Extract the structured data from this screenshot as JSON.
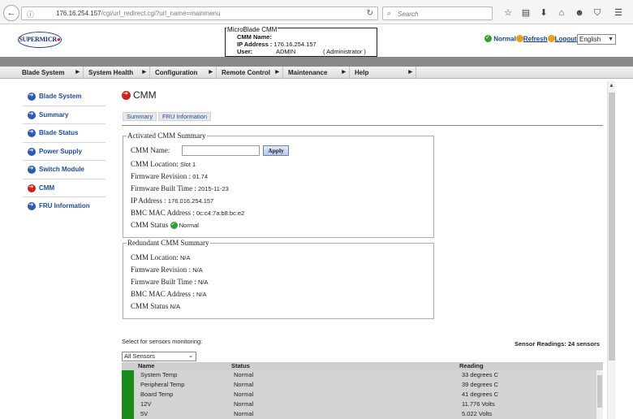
{
  "browser": {
    "url_main": "176.16.254.157",
    "url_path": "/cgi/url_redirect.cgi?url_name=mainmenu",
    "search_placeholder": "Search"
  },
  "header": {
    "logo_text": "SUPERMICR",
    "logo_dot": "●",
    "box_title": "MicroBlade CMM",
    "cmm_name_label": "CMM Name:",
    "ip_label": "IP Address :",
    "ip_value": "176.16.254.157",
    "user_label": "User:",
    "user_value": "ADMIN",
    "user_role": "( Administrator )",
    "status": "Normal",
    "refresh": "Refresh",
    "logout": "Logout",
    "language": "English"
  },
  "menu": [
    {
      "label": "Blade System"
    },
    {
      "label": "System Health"
    },
    {
      "label": "Configuration"
    },
    {
      "label": "Remote Control"
    },
    {
      "label": "Maintenance"
    },
    {
      "label": "Help"
    }
  ],
  "sidebar": [
    {
      "label": "Blade System"
    },
    {
      "label": "Summary"
    },
    {
      "label": "Blade Status"
    },
    {
      "label": "Power Supply"
    },
    {
      "label": "Switch Module"
    },
    {
      "label": "CMM"
    },
    {
      "label": "FRU Information"
    }
  ],
  "main": {
    "title": "CMM",
    "tabs": [
      {
        "label": "Summary"
      },
      {
        "label": "FRU Information"
      }
    ],
    "activated": {
      "legend": "Activated CMM Summary",
      "cmm_name_label": "CMM Name:",
      "cmm_name_value": "",
      "apply": "Apply",
      "location_label": "CMM Location:",
      "location_value": "Slot 1",
      "fw_label": "Firmware Revision :",
      "fw_value": "01.74",
      "built_label": "Firmware Built Time :",
      "built_value": "2015-11-23",
      "ip_label": "IP Address :",
      "ip_value": "176.016.254.157",
      "mac_label": "BMC MAC Address :",
      "mac_value": "0c:c4:7a:b8:bc:e2",
      "status_label": "CMM Status",
      "status_value": "Normal"
    },
    "redundant": {
      "legend": "Redundant CMM Summary",
      "location_label": "CMM Location:",
      "location_value": "N/A",
      "fw_label": "Firmware Revision :",
      "fw_value": "N/A",
      "built_label": "Firmware Built Time :",
      "built_value": "N/A",
      "mac_label": "BMC MAC Address :",
      "mac_value": "N/A",
      "status_label": "CMM Status",
      "status_value": "N/A"
    },
    "sensors": {
      "select_label": "Select for sensors monitoring:",
      "count_text": "Sensor Readings: 24 sensors",
      "filter_value": "All Sensors",
      "columns": [
        "Name",
        "Status",
        "Reading"
      ],
      "rows": [
        {
          "name": "System Temp",
          "status": "Normal",
          "reading": "33 degrees C"
        },
        {
          "name": "Peripheral Temp",
          "status": "Normal",
          "reading": "39 degrees C"
        },
        {
          "name": "Board Temp",
          "status": "Normal",
          "reading": "41 degrees C"
        },
        {
          "name": "12V",
          "status": "Normal",
          "reading": "11.776 Volts"
        },
        {
          "name": "5V",
          "status": "Normal",
          "reading": "5.022 Volts"
        }
      ]
    }
  },
  "colors": {
    "link": "#1f4aa0",
    "status_ok": "#2ea02e",
    "active_icon": "#d02020",
    "row_ok": "#1a8a1a"
  },
  "icons": {
    "nav": "back-arrow-icon",
    "side": "arrow-circle-icon",
    "status": "check-circle-icon"
  }
}
